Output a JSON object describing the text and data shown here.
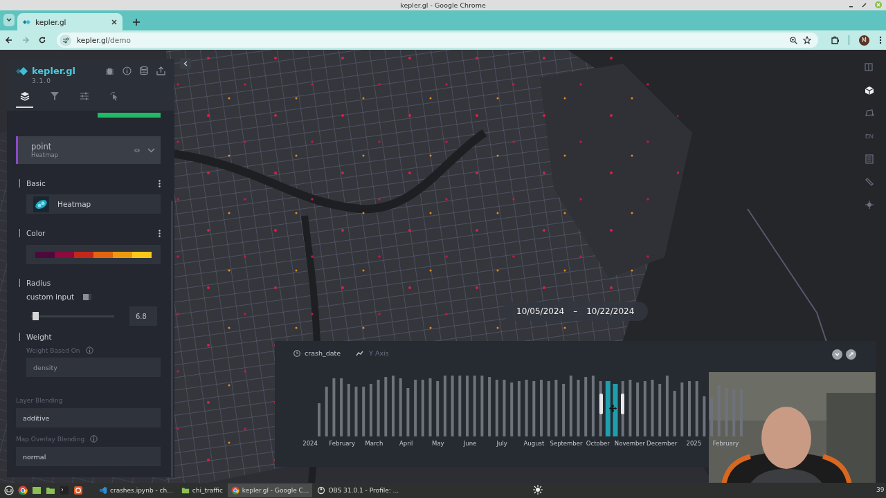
{
  "window": {
    "title": "kepler.gl - Google Chrome"
  },
  "browser": {
    "tabs": [
      {
        "title": "kepler.gl",
        "selected": true
      }
    ],
    "address": {
      "host": "kepler.gl",
      "path": "/demo"
    },
    "profile_initial": "M"
  },
  "sidebar": {
    "app_name": "kepler.gl",
    "version": "3.1.0",
    "panel_tabs": [
      {
        "kind": "layers",
        "selected": true
      },
      {
        "kind": "filters",
        "selected": false
      },
      {
        "kind": "settings",
        "selected": false
      },
      {
        "kind": "interactions",
        "selected": false
      }
    ],
    "layer": {
      "name": "point",
      "type": "Heatmap",
      "color": "#8a49c9"
    },
    "basic": {
      "title": "Basic",
      "layer_type": "Heatmap"
    },
    "color": {
      "title": "Color",
      "swatches": [
        {
          "color": "#4c0a3b"
        },
        {
          "color": "#8c0a3c"
        },
        {
          "color": "#c2271b"
        },
        {
          "color": "#df6510"
        },
        {
          "color": "#ec9910"
        },
        {
          "color": "#f7c818"
        }
      ]
    },
    "radius": {
      "title": "Radius",
      "custom_input_label": "custom input",
      "custom_input_on": false,
      "level": 0.05,
      "value": "6.8"
    },
    "weight": {
      "title": "Weight",
      "label": "Weight Based On",
      "value": "density",
      "disabled": true
    },
    "layer_blending": {
      "label": "Layer Blending",
      "value": "additive"
    },
    "overlay_blending": {
      "label": "Map Overlay Blending",
      "value": "normal"
    }
  },
  "map": {
    "date_range": {
      "start": "10/05/2024",
      "separator": "–",
      "end": "10/22/2024"
    },
    "toolbar": [
      {
        "kind": "split",
        "selected": false
      },
      {
        "kind": "cube",
        "selected": true
      },
      {
        "kind": "draw",
        "selected": false
      },
      {
        "kind": "locale",
        "label": "EN",
        "selected": false
      },
      {
        "kind": "legend",
        "selected": false
      },
      {
        "kind": "ruler",
        "selected": false
      },
      {
        "kind": "pin",
        "selected": false
      }
    ]
  },
  "timeline": {
    "field": "crash_date",
    "y_axis": "Y Axis",
    "x_labels": [
      "2024",
      "February",
      "March",
      "April",
      "May",
      "June",
      "July",
      "August",
      "September",
      "October",
      "November",
      "December",
      "2025",
      "February"
    ]
  },
  "taskbar": {
    "launchers": [
      {
        "kind": "mint"
      },
      {
        "kind": "chrome"
      },
      {
        "kind": "green"
      },
      {
        "kind": "folder"
      },
      {
        "kind": "terminal"
      },
      {
        "kind": "orange"
      }
    ],
    "items": [
      {
        "kind": "vscode",
        "label": "crashes.ipynb - ch...",
        "selected": false
      },
      {
        "kind": "folder",
        "label": "chi_traffic",
        "selected": false
      },
      {
        "kind": "chrome",
        "label": "kepler.gl - Google C...",
        "selected": true
      },
      {
        "kind": "obs",
        "label": "OBS 31.0.1 - Profile: ...",
        "selected": false
      }
    ],
    "clock": "39"
  }
}
